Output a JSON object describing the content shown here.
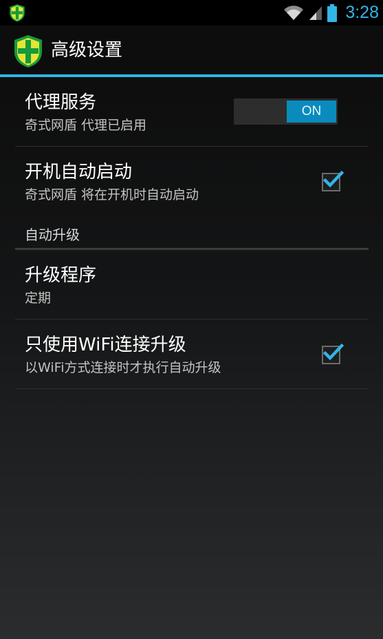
{
  "status_bar": {
    "time": "3:28",
    "icons": [
      "app-shield-icon",
      "wifi-icon",
      "cell-signal-icon",
      "battery-icon"
    ],
    "accent_color": "#33b5e5"
  },
  "action_bar": {
    "title": "高级设置",
    "app_icon": "app-shield-icon",
    "divider_color": "#33b5e5"
  },
  "preferences": [
    {
      "title": "代理服务",
      "summary": "奇式网盾 代理已启用",
      "widget": "switch",
      "state_label": "ON",
      "checked": true
    },
    {
      "title": "开机自动启动",
      "summary": "奇式网盾 将在开机时自动启动",
      "widget": "checkbox",
      "checked": true
    }
  ],
  "category": {
    "label": "自动升级"
  },
  "upgrade_preferences": [
    {
      "title": "升级程序",
      "summary": "定期"
    },
    {
      "title": "只使用WiFi连接升级",
      "summary": "以WiFi方式连接时才执行自动升级",
      "widget": "checkbox",
      "checked": true
    }
  ]
}
